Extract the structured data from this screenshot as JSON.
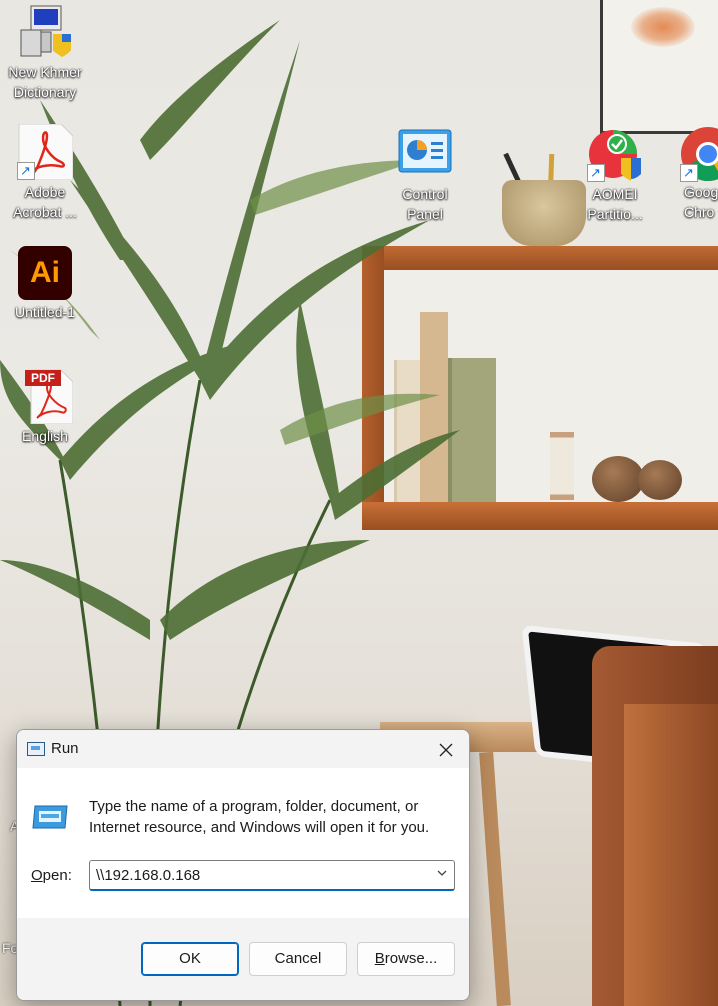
{
  "desktop": {
    "icons": [
      {
        "label_line1": "New Khmer",
        "label_line2": "Dictionary",
        "icon": "installer-icon"
      },
      {
        "label_line1": "Adobe",
        "label_line2": "Acrobat ...",
        "icon": "acrobat-icon"
      },
      {
        "label_line1": "Untitled-1",
        "label_line2": "",
        "icon": "illustrator-icon",
        "icon_text": "Ai"
      },
      {
        "label_line1": "English",
        "label_line2": "",
        "icon": "pdf-file-icon",
        "icon_text": "PDF"
      },
      {
        "label_line1": "Control Panel",
        "label_line2": "",
        "icon": "control-panel-icon"
      },
      {
        "label_line1": "AOMEI",
        "label_line2": "Partitio...",
        "icon": "aomei-partition-icon"
      },
      {
        "label_line1": "Goog",
        "label_line2": "Chro",
        "icon": "chrome-icon"
      }
    ],
    "partial_labels": [
      "A",
      "Fo"
    ]
  },
  "run_dialog": {
    "title": "Run",
    "description": "Type the name of a program, folder, document, or Internet resource, and Windows will open it for you.",
    "open_label_mnemonic": "O",
    "open_label_rest": "pen:",
    "open_value": "\\\\192.168.0.168",
    "ok_label": "OK",
    "cancel_label": "Cancel",
    "browse_mnemonic": "B",
    "browse_rest": "rowse..."
  },
  "colors": {
    "accent": "#0067c0",
    "dialog_bg": "#ffffff",
    "dialog_chrome": "#f3f3f3"
  }
}
